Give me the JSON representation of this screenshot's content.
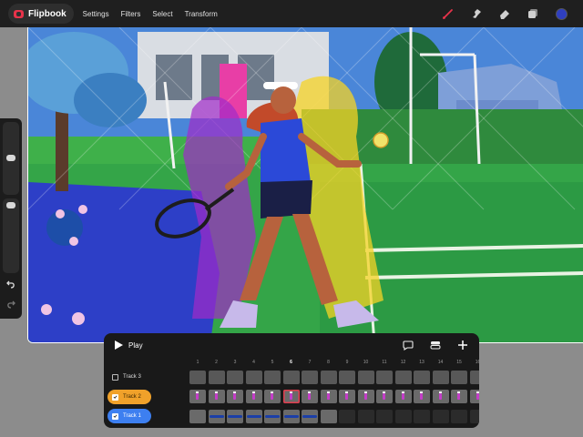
{
  "app": {
    "name": "Flipbook"
  },
  "menu": [
    "Settings",
    "Filters",
    "Select",
    "Transform"
  ],
  "tools": [
    {
      "name": "brush-icon",
      "color": "#e8334a"
    },
    {
      "name": "smudge-icon",
      "color": "#d0d0d0"
    },
    {
      "name": "eraser-icon",
      "color": "#d0d0d0"
    },
    {
      "name": "layers-icon",
      "color": "#d0d0d0"
    }
  ],
  "current_color": "#2f3fbf",
  "timeline": {
    "play_label": "Play",
    "frame_numbers": [
      "1",
      "2",
      "3",
      "4",
      "5",
      "6",
      "7",
      "8",
      "9",
      "10",
      "11",
      "12",
      "13",
      "14",
      "15",
      "16"
    ],
    "current_frame": 6,
    "tracks": [
      {
        "label": "Track 3",
        "checked": false,
        "filled_frames": 16,
        "color": ""
      },
      {
        "label": "Track 2",
        "checked": true,
        "filled_frames": 16,
        "color": "#f0a12a"
      },
      {
        "label": "Track 1",
        "checked": true,
        "filled_frames": 8,
        "color": "#3d7ff0"
      }
    ]
  },
  "icons": {
    "play": "play-icon",
    "comment": "comment-icon",
    "layers": "stack-icon",
    "add": "plus-icon",
    "undo": "undo-icon",
    "redo": "redo-icon"
  }
}
